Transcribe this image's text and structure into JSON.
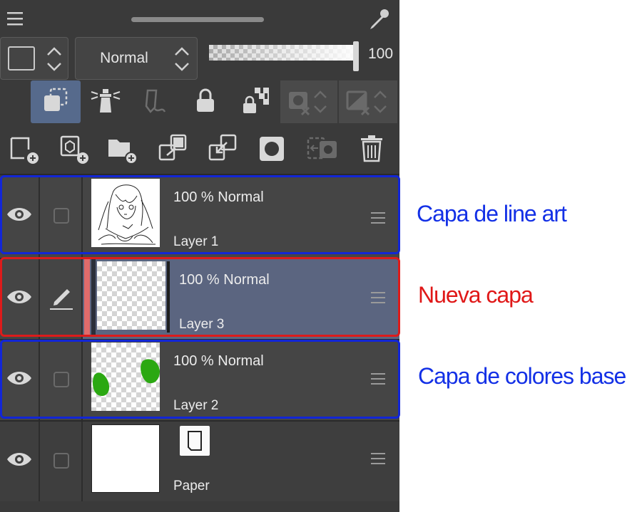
{
  "header": {
    "menu_icon": "hamburger-icon",
    "eyedropper_icon": "eyedropper-icon"
  },
  "properties": {
    "blend_mode": "Normal",
    "opacity_value": "100",
    "opacity_fraction": 1.0
  },
  "tool_row_1": [
    {
      "name": "clip-to-layer-below",
      "icon": "clip-layers-icon",
      "active": true
    },
    {
      "name": "set-as-reference-layer",
      "icon": "lighthouse-icon",
      "active": false
    },
    {
      "name": "set-as-draft-layer",
      "icon": "draft-pen-icon",
      "active": false
    },
    {
      "name": "lock-layer",
      "icon": "lock-icon",
      "active": false
    },
    {
      "name": "lock-transparent-pixels",
      "icon": "lock-transparency-icon",
      "active": false
    },
    {
      "name": "show-mask-area",
      "icon": "mask-area-icon",
      "active": false
    },
    {
      "name": "enable-mask",
      "icon": "mask-disable-icon",
      "active": false
    }
  ],
  "tool_row_2": [
    {
      "name": "new-raster-layer",
      "icon": "new-raster-layer-icon"
    },
    {
      "name": "new-vector-layer",
      "icon": "new-vector-layer-icon"
    },
    {
      "name": "new-folder",
      "icon": "new-folder-icon"
    },
    {
      "name": "transfer-to-lower-layer",
      "icon": "transfer-down-icon"
    },
    {
      "name": "combine-with-layer-below",
      "icon": "merge-down-icon"
    },
    {
      "name": "create-layer-mask",
      "icon": "layer-mask-icon"
    },
    {
      "name": "apply-mask",
      "icon": "apply-mask-icon"
    },
    {
      "name": "delete-layer",
      "icon": "trash-icon"
    }
  ],
  "layers": [
    {
      "name": "Layer 1",
      "opacity_mode": "100 % Normal",
      "editing": false
    },
    {
      "name": "Layer 3",
      "opacity_mode": "100 % Normal",
      "editing": true
    },
    {
      "name": "Layer 2",
      "opacity_mode": "100 % Normal",
      "editing": false
    },
    {
      "name": "Paper",
      "opacity_mode": "",
      "editing": false
    }
  ],
  "annotations": {
    "lineart": "Capa de line art",
    "new": "Nueva capa",
    "base": "Capa de colores base"
  },
  "colors": {
    "panel_bg": "#3a3a3a",
    "layer_bg": "#454545",
    "selected_layer_bg": "#5b6580",
    "active_tool_bg": "#566a8c",
    "frame_blue": "#1226d6",
    "frame_red": "#dc1b1b",
    "annotation_blue": "#1330e6",
    "annotation_red": "#e01818",
    "color_bar": "#e06b6b",
    "green_blob": "#2ba812"
  }
}
